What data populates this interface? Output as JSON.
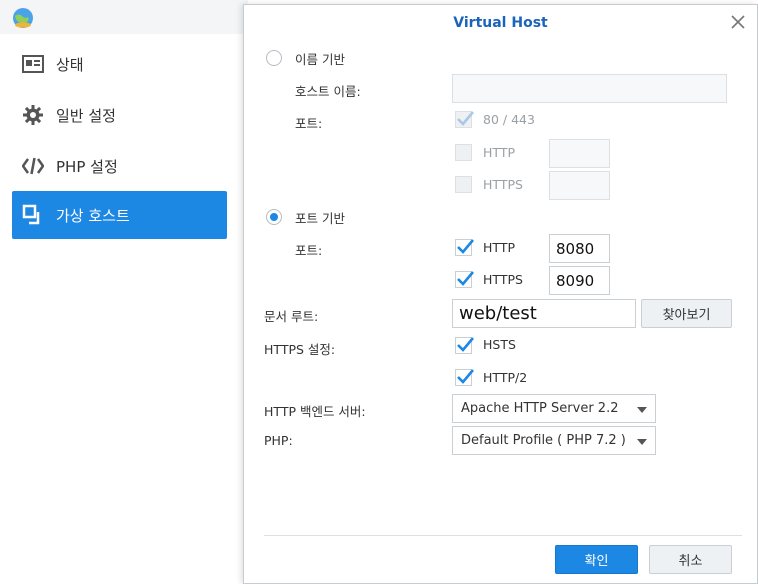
{
  "sidebar": {
    "logo_icon": "globe-icon",
    "items": [
      {
        "label": "상태",
        "icon": "status-card-icon",
        "active": false
      },
      {
        "label": "일반 설정",
        "icon": "gear-icon",
        "active": false
      },
      {
        "label": "PHP 설정",
        "icon": "code-icon",
        "active": false
      },
      {
        "label": "가상 호스트",
        "icon": "virtual-host-icon",
        "active": true
      }
    ]
  },
  "dialog": {
    "title": "Virtual Host",
    "name_based": {
      "radio_label": "이름 기반",
      "selected": false,
      "hostname_label": "호스트 이름:",
      "hostname_value": "",
      "port_label": "포트:",
      "port_default": {
        "label": "80 / 443",
        "checked": true,
        "disabled": true
      },
      "http": {
        "label": "HTTP",
        "checked": false,
        "disabled": true,
        "value": ""
      },
      "https": {
        "label": "HTTPS",
        "checked": false,
        "disabled": true,
        "value": ""
      }
    },
    "port_based": {
      "radio_label": "포트 기반",
      "selected": true,
      "port_label": "포트:",
      "http": {
        "label": "HTTP",
        "checked": true,
        "value": "8080"
      },
      "https": {
        "label": "HTTPS",
        "checked": true,
        "value": "8090"
      }
    },
    "doc_root": {
      "label": "문서 루트:",
      "value": "web/test",
      "browse_label": "찾아보기"
    },
    "https_settings": {
      "label": "HTTPS 설정:",
      "hsts": {
        "label": "HSTS",
        "checked": true
      },
      "http2": {
        "label": "HTTP/2",
        "checked": true
      }
    },
    "backend": {
      "label": "HTTP 백엔드 서버:",
      "value": "Apache HTTP Server 2.2"
    },
    "php": {
      "label": "PHP:",
      "value": "Default Profile ( PHP 7.2 )"
    },
    "ok_label": "확인",
    "cancel_label": "취소"
  },
  "colors": {
    "accent": "#1d87e4",
    "title": "#1a65b8"
  }
}
